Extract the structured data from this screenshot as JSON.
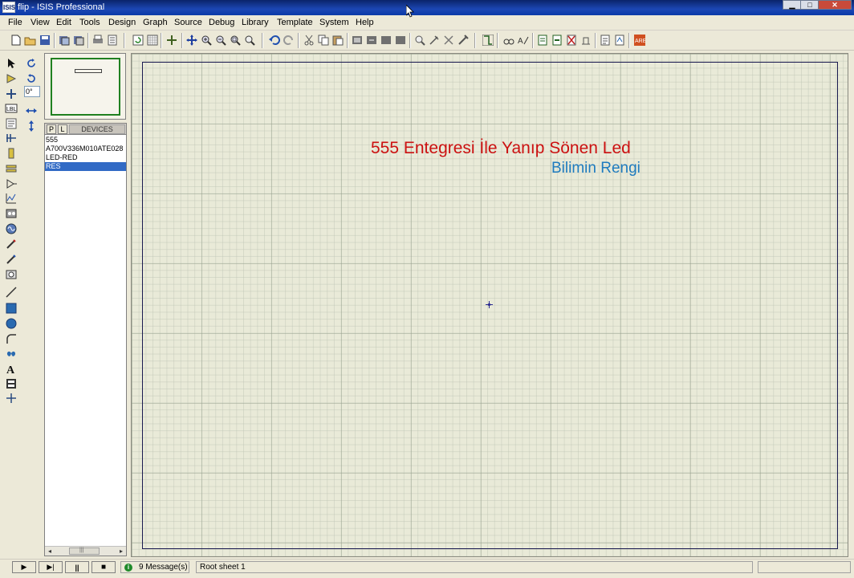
{
  "window": {
    "app_icon_text": "ISIS",
    "title": "flip - ISIS Professional",
    "min_glyph": "▁",
    "max_glyph": "□",
    "close_glyph": "✕"
  },
  "menu": [
    "File",
    "View",
    "Edit",
    "Tools",
    "Design",
    "Graph",
    "Source",
    "Debug",
    "Library",
    "Template",
    "System",
    "Help"
  ],
  "toolbar_icons": [
    "new-file",
    "open-folder",
    "save",
    "import",
    "export",
    "print",
    "print-setup",
    "refresh",
    "grid",
    "origin",
    "pan",
    "zoom-in",
    "zoom-out",
    "zoom-all",
    "zoom-area",
    "undo",
    "redo",
    "cut",
    "copy",
    "paste",
    "block-copy",
    "block-move",
    "block-rotate",
    "block-delete",
    "pick-device",
    "make-device",
    "packaging",
    "decompose",
    "wire-autorouter",
    "search-tag",
    "property-assign",
    "new-sheet",
    "remove-sheet",
    "goto-sheet",
    "bill-of-materials",
    "netlist",
    "electrical-rules",
    "netlist-ares"
  ],
  "left_toolbar_icons": [
    "selection",
    "component",
    "junction",
    "wire-label",
    "text-script",
    "bus",
    "subcircuit",
    "terminal",
    "device-pin",
    "graph",
    "tape-recorder",
    "generator",
    "voltage-probe",
    "current-probe",
    "virtual-instrument",
    "line-2d",
    "box-2d",
    "circle-2d",
    "arc-2d",
    "path-2d",
    "text-2d",
    "symbol-2d",
    "marker-2d"
  ],
  "rotation": {
    "value": "0°",
    "rotate_cw": "rotate-cw",
    "rotate_ccw": "rotate-ccw",
    "mirror_x": "mirror-horizontal",
    "mirror_y": "mirror-vertical"
  },
  "device_selector": {
    "p_label": "P",
    "l_label": "L",
    "title": "DEVICES",
    "items": [
      "555",
      "A700V336M010ATE028",
      "LED-RED",
      "RES"
    ],
    "selected_index": 3,
    "scroll_left": "◂",
    "scroll_right": "▸",
    "thumb_grip": "|||"
  },
  "schematic": {
    "title": "555 Entegresi İle Yanıp Sönen Led",
    "subtitle": "Bilimin Rengi",
    "title_color": "#cc1111",
    "subtitle_color": "#1e7bbf"
  },
  "status": {
    "play": "▶",
    "step": "▶|",
    "pause": "||",
    "stop": "■",
    "messages": "9 Message(s)",
    "message_icon": "i",
    "sheet": "Root sheet 1"
  }
}
